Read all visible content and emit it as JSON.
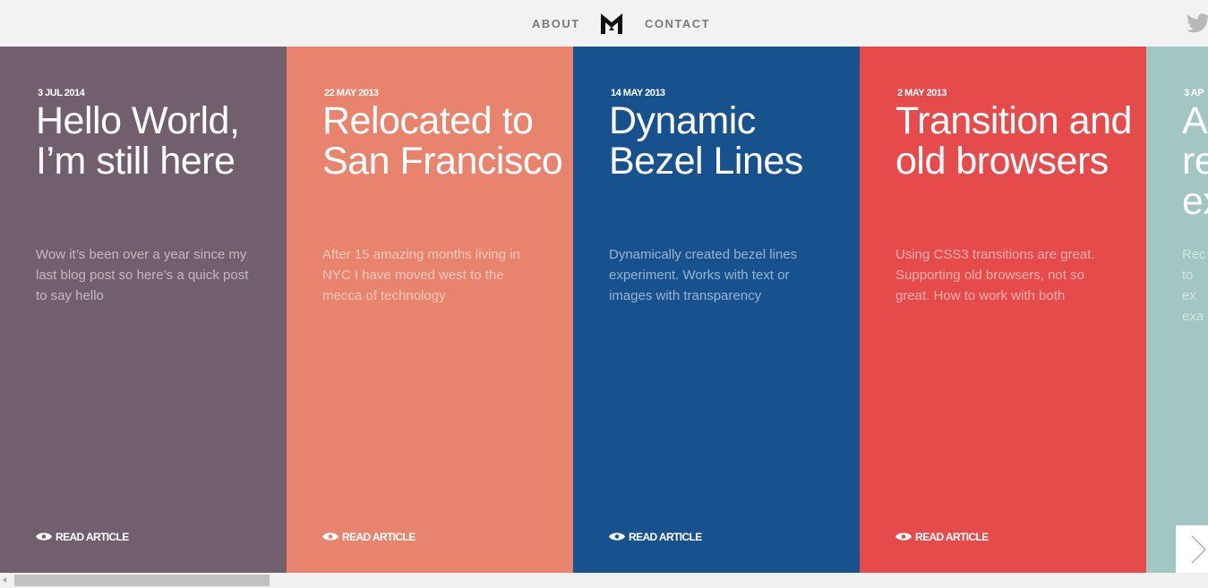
{
  "header": {
    "about_label": "ABOUT",
    "contact_label": "CONTACT",
    "logo_icon": "monogram-logo-icon",
    "twitter_icon": "twitter-bird-icon"
  },
  "read_label": "READ ARTICLE",
  "posts": [
    {
      "date": "3 JUL 2014",
      "title": "Hello World, I’m still here",
      "excerpt": "Wow it’s been over a year since my last blog post so here’s a quick post to say hello",
      "color": "#715f6e"
    },
    {
      "date": "22 MAY 2013",
      "title": "Relocated to San Francisco",
      "excerpt": "After 15 amazing months living in NYC I have moved west to the mecca of technology",
      "color": "#e8846d"
    },
    {
      "date": "14 MAY 2013",
      "title": "Dynamic Bezel Lines",
      "excerpt": "Dynamically created bezel lines experiment. Works with text or images with transparency",
      "color": "#17528f"
    },
    {
      "date": "2 MAY 2013",
      "title": "Transition and old browsers",
      "excerpt": "Using CSS3 transitions are great. Supporting old browsers, not so great. How to work with both",
      "color": "#e54b4b"
    },
    {
      "date": "3 AP",
      "title": "A re ex",
      "excerpt": "Rec to ex exa",
      "color": "#a2c6c1"
    }
  ],
  "next_icon": "chevron-right-icon",
  "eye_icon": "eye-icon"
}
